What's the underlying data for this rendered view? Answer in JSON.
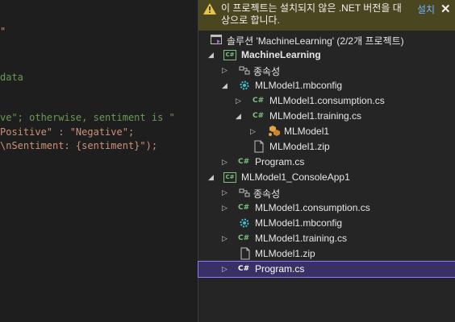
{
  "editor": {
    "lines": [
      {
        "text": "\"",
        "color": "#ce9178",
        "cls": "tok-str"
      },
      {
        "text": "data",
        "color": "#6a9955",
        "cls": "tok-comment"
      },
      {
        "text": "ve\"; otherwise, sentiment is \"",
        "color": "#6a9955",
        "cls": "tok-comment"
      },
      {
        "text": "Positive\" : \"Negative\";",
        "color": "#ce9178",
        "cls": "tok-str"
      },
      {
        "text": "\\nSentiment: {sentiment}\");",
        "color": "#ce9178",
        "cls": "tok-str"
      }
    ]
  },
  "infobar": {
    "message": "이 프로젝트는 설치되지 않은 .NET 버전을 대상으로 합니다.",
    "link": "설치",
    "close": "✕",
    "icon": "warning-icon",
    "color": "#e8c547"
  },
  "tree": {
    "solution": "솔루션 'MachineLearning' (2/2개 프로젝트)",
    "project1": {
      "name": "MachineLearning",
      "deps": "종속성",
      "mbconfig": "MLModel1.mbconfig",
      "consumption": "MLModel1.consumption.cs",
      "training": "MLModel1.training.cs",
      "model_class": "MLModel1",
      "zip": "MLModel1.zip",
      "program": "Program.cs"
    },
    "project2": {
      "name": "MLModel1_ConsoleApp1",
      "deps": "종속성",
      "consumption": "MLModel1.consumption.cs",
      "mbconfig": "MLModel1.mbconfig",
      "training": "MLModel1.training.cs",
      "zip": "MLModel1.zip",
      "program": "Program.cs"
    },
    "cs_badge": "C#",
    "csproj_badge": "C#"
  },
  "colors": {
    "accent_selected": "#3a3066",
    "cs_green": "#7ec27e",
    "link": "#6cb6ff"
  }
}
